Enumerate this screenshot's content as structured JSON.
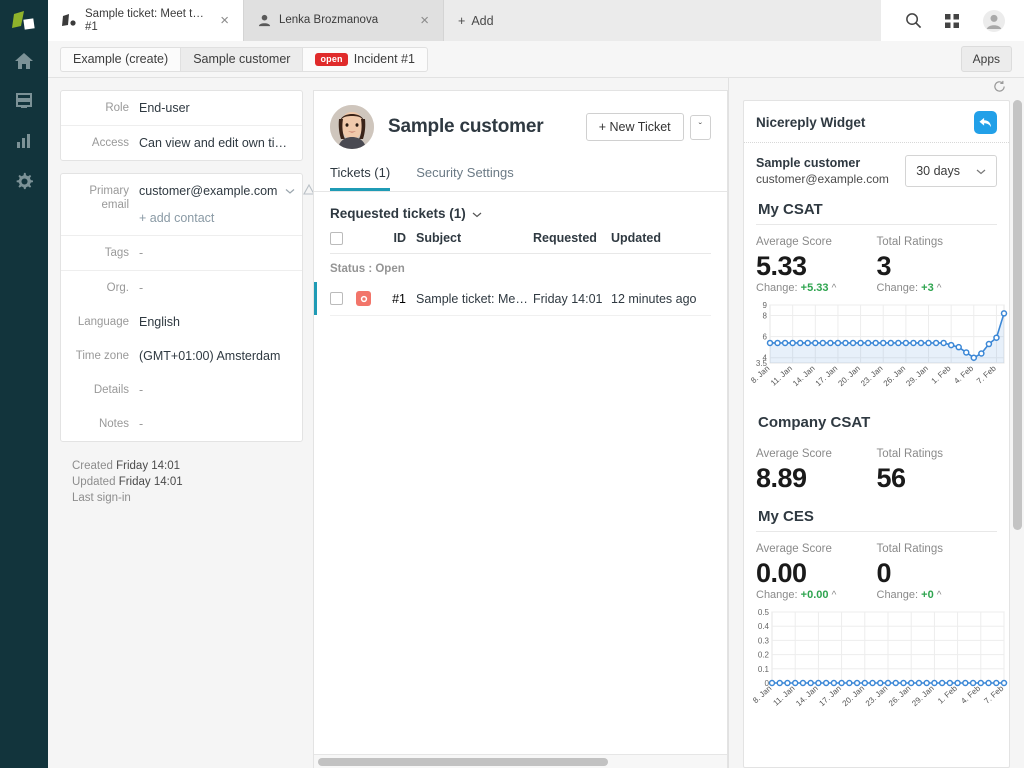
{
  "rail": {
    "logo": "zammad-logo",
    "items": [
      {
        "name": "home-icon",
        "label": "Home"
      },
      {
        "name": "overviews-icon",
        "label": "Overviews"
      },
      {
        "name": "reporting-icon",
        "label": "Reporting"
      },
      {
        "name": "settings-gear-icon",
        "label": "Settings"
      }
    ]
  },
  "tabs": [
    {
      "line1": "Sample ticket: Meet the ti...",
      "line2": "#1",
      "icon": "ticket-icon",
      "active": true,
      "close": "×"
    },
    {
      "line1": "Lenka Brozmanova",
      "line2": "",
      "icon": "user-icon",
      "active": false,
      "close": "×"
    }
  ],
  "add_tab": {
    "label": "Add",
    "plus": "+"
  },
  "topbar_icons": [
    {
      "name": "search-icon"
    },
    {
      "name": "grid-apps-icon"
    },
    {
      "name": "user-avatar-icon"
    }
  ],
  "breadcrumb": {
    "items": [
      {
        "label": "Example (create)",
        "selected": false,
        "badge": ""
      },
      {
        "label": "Sample customer",
        "selected": true,
        "badge": ""
      },
      {
        "label": "Incident #1",
        "selected": false,
        "badge": "open"
      }
    ],
    "apps_button": "Apps"
  },
  "customer_fields": {
    "card1": [
      {
        "label": "Role",
        "value": "End-user"
      },
      {
        "label": "Access",
        "value": "Can view and edit own tic..."
      }
    ],
    "email": {
      "label": "Primary email",
      "label_l1": "Primary",
      "label_l2": "email",
      "value": "customer@example.com",
      "add_contact": "+ add contact"
    },
    "card2": [
      {
        "label": "Tags",
        "value": "-"
      },
      {
        "label": "Org.",
        "value": "-"
      },
      {
        "label": "Language",
        "value": "English"
      },
      {
        "label": "Time zone",
        "value": "(GMT+01:00) Amsterdam"
      },
      {
        "label": "Details",
        "value": "-"
      },
      {
        "label": "Notes",
        "value": "-"
      }
    ],
    "meta": [
      {
        "label": "Created",
        "value": "Friday 14:01"
      },
      {
        "label": "Updated",
        "value": "Friday 14:01"
      },
      {
        "label": "Last sign-in",
        "value": ""
      }
    ]
  },
  "center": {
    "customer_name": "Sample customer",
    "new_ticket_button": "+ New Ticket",
    "caret": "ˇ",
    "tabs": [
      {
        "label": "Tickets (1)",
        "active": true
      },
      {
        "label": "Security Settings",
        "active": false
      }
    ],
    "section_title": "Requested tickets (1)",
    "section_caret": "ˇ",
    "table": {
      "headers": [
        "ID",
        "Subject",
        "Requested",
        "Updated"
      ],
      "group_label": "Status : Open",
      "rows": [
        {
          "id": "#1",
          "subject": "Sample ticket: Meet the ticket",
          "requested": "Friday 14:01",
          "updated": "12 minutes ago"
        }
      ]
    }
  },
  "widget": {
    "refresh_icon": "refresh-icon",
    "title": "Nicereply Widget",
    "logo_icon": "nicereply-reply-icon",
    "customer_name": "Sample customer",
    "customer_email": "customer@example.com",
    "range": "30 days",
    "range_caret": "ˇ",
    "sections": [
      {
        "title": "My CSAT",
        "avg_label": "Average Score",
        "avg_value": "5.33",
        "avg_change_prefix": "Change:",
        "avg_change": "+5.33",
        "total_label": "Total Ratings",
        "total_value": "3",
        "total_change_prefix": "Change:",
        "total_change": "+3"
      },
      {
        "title": "Company CSAT",
        "avg_label": "Average Score",
        "avg_value": "8.89",
        "total_label": "Total Ratings",
        "total_value": "56"
      },
      {
        "title": "My CES",
        "avg_label": "Average Score",
        "avg_value": "0.00",
        "avg_change_prefix": "Change:",
        "avg_change": "+0.00",
        "total_label": "Total Ratings",
        "total_value": "0",
        "total_change_prefix": "Change:",
        "total_change": "+0"
      }
    ],
    "colors": {
      "accent_blue": "#3b87d6",
      "positive_green": "#2ea44f",
      "logo_blue": "#22a0e8"
    }
  },
  "chart_data": [
    {
      "type": "line",
      "title": "My CSAT",
      "xlabel": "",
      "ylabel": "",
      "ylim": [
        3.5,
        9
      ],
      "yticks": [
        3.5,
        4,
        6,
        8,
        9
      ],
      "ytick_labels": [
        "3.5",
        "4",
        "6",
        "8",
        "9"
      ],
      "grid": true,
      "legend": "none",
      "x": [
        "8. Jan",
        "9. Jan",
        "10. Jan",
        "11. Jan",
        "12. Jan",
        "13. Jan",
        "14. Jan",
        "15. Jan",
        "16. Jan",
        "17. Jan",
        "18. Jan",
        "19. Jan",
        "20. Jan",
        "21. Jan",
        "22. Jan",
        "23. Jan",
        "24. Jan",
        "25. Jan",
        "26. Jan",
        "27. Jan",
        "28. Jan",
        "29. Jan",
        "30. Jan",
        "31. Jan",
        "1. Feb",
        "2. Feb",
        "3. Feb",
        "4. Feb",
        "5. Feb",
        "6. Feb",
        "7. Feb"
      ],
      "xtick_labels": [
        "8. Jan",
        "11. Jan",
        "14. Jan",
        "17. Jan",
        "20. Jan",
        "23. Jan",
        "26. Jan",
        "29. Jan",
        "1. Feb",
        "4. Feb",
        "7. Feb"
      ],
      "values": [
        5.4,
        5.4,
        5.4,
        5.4,
        5.4,
        5.4,
        5.4,
        5.4,
        5.4,
        5.4,
        5.4,
        5.4,
        5.4,
        5.4,
        5.4,
        5.4,
        5.4,
        5.4,
        5.4,
        5.4,
        5.4,
        5.4,
        5.4,
        5.4,
        5.2,
        5.0,
        4.5,
        4.0,
        4.4,
        5.3,
        5.9,
        8.2
      ],
      "series_color": "#3b87d6",
      "fill": true
    },
    {
      "type": "line",
      "title": "My CES",
      "xlabel": "",
      "ylabel": "",
      "ylim": [
        0,
        0.5
      ],
      "yticks": [
        0,
        0.1,
        0.2,
        0.3,
        0.4,
        0.5
      ],
      "ytick_labels": [
        "0",
        "0.1",
        "0.2",
        "0.3",
        "0.4",
        "0.5"
      ],
      "grid": true,
      "legend": "none",
      "x": [
        "8. Jan",
        "9. Jan",
        "10. Jan",
        "11. Jan",
        "12. Jan",
        "13. Jan",
        "14. Jan",
        "15. Jan",
        "16. Jan",
        "17. Jan",
        "18. Jan",
        "19. Jan",
        "20. Jan",
        "21. Jan",
        "22. Jan",
        "23. Jan",
        "24. Jan",
        "25. Jan",
        "26. Jan",
        "27. Jan",
        "28. Jan",
        "29. Jan",
        "30. Jan",
        "31. Jan",
        "1. Feb",
        "2. Feb",
        "3. Feb",
        "4. Feb",
        "5. Feb",
        "6. Feb",
        "7. Feb"
      ],
      "xtick_labels": [
        "8. Jan",
        "11. Jan",
        "14. Jan",
        "17. Jan",
        "20. Jan",
        "23. Jan",
        "26. Jan",
        "29. Jan",
        "1. Feb",
        "4. Feb",
        "7. Feb"
      ],
      "values": [
        0,
        0,
        0,
        0,
        0,
        0,
        0,
        0,
        0,
        0,
        0,
        0,
        0,
        0,
        0,
        0,
        0,
        0,
        0,
        0,
        0,
        0,
        0,
        0,
        0,
        0,
        0,
        0,
        0,
        0,
        0
      ],
      "series_color": "#3b87d6",
      "fill": false
    }
  ]
}
